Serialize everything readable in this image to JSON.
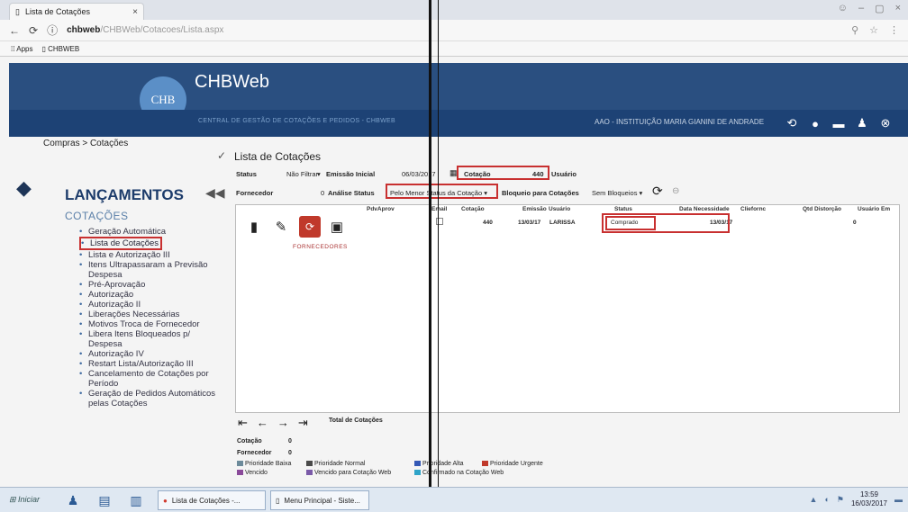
{
  "browser": {
    "tab_title": "Lista de Cotações",
    "url_host": "chbweb",
    "url_rest": "/CHBWeb/Cotacoes/Lista.aspx",
    "bookmarks": [
      "Apps",
      "CHBWEB"
    ]
  },
  "header": {
    "logo_text": "CHB",
    "brand": "CHBWeb",
    "info": "CENTRAL DE GESTÃO DE COTAÇÕES E PEDIDOS - CHBWEB",
    "user": "AAO - INSTITUIÇÃO MARIA GIANINI DE ANDRADE"
  },
  "breadcrumb": "Compras > Cotações",
  "sidebar": {
    "title": "LANÇAMENTOS",
    "subtitle": "COTAÇÕES",
    "items": [
      "Geração Automática",
      "Lista de Cotações",
      "Lista e Autorização III",
      "Itens Ultrapassaram a Previsão Despesa",
      "Pré-Aprovação",
      "Autorização",
      "Autorização II",
      "Liberações Necessárias",
      "Motivos Troca de Fornecedor",
      "Libera Itens Bloqueados p/ Despesa",
      "Autorização IV",
      "Restart Lista/Autorização III",
      "Cancelamento de Cotações por Período",
      "Geração de Pedidos Automáticos pelas Cotações"
    ]
  },
  "form": {
    "title": "Lista de Cotações",
    "status_label": "Status",
    "status_value": "Não Filtrar",
    "emissao_label": "Emissão Inicial",
    "emissao_value": "06/03/2017",
    "cotacao_label": "Cotação",
    "cotacao_value": "440",
    "usuario_label": "Usuário",
    "fornecedor_label": "Fornecedor",
    "fornecedor_value": "0",
    "analise_label": "Análise Status",
    "analise_value": "Pelo Menor Status da Cotação",
    "bloqueio_label": "Bloqueio para Cotações",
    "bloqueio_value": "Sem Bloqueios"
  },
  "grid": {
    "columns": [
      "PdvAprov",
      "Email",
      "Cotação",
      "Emissão",
      "Usuário",
      "Status",
      "Data Necessidade",
      "Cliefornc",
      "Qtd Distorção",
      "Usuário Em"
    ],
    "row": {
      "cotacao": "440",
      "emissao": "13/03/17",
      "usuario": "LARISSA",
      "status": "Comprado",
      "data_necessidade": "13/03/17",
      "qtd": "0"
    },
    "fornecedores_link": "FORNECEDORES"
  },
  "footer": {
    "total_label": "Total de Cotações",
    "cotacao_label": "Cotação",
    "cotacao_value": "0",
    "fornecedor_label": "Fornecedor",
    "fornecedor_value": "0",
    "legend": [
      {
        "label": "Prioridade Baixa",
        "color": "#6c8a9a"
      },
      {
        "label": "Prioridade Normal",
        "color": "#4a4a4a"
      },
      {
        "label": "Prioridade Alta",
        "color": "#3358b5"
      },
      {
        "label": "Prioridade Urgente",
        "color": "#c0392b"
      },
      {
        "label": "Vencido",
        "color": "#8a4a9a"
      },
      {
        "label": "Vencido para Cotação Web",
        "color": "#7a5aa8"
      },
      {
        "label": "Confirmado na Cotação Web",
        "color": "#2fa4c8"
      }
    ]
  },
  "taskbar": {
    "start": "Iniciar",
    "apps": [
      "Lista de Cotações -...",
      "Menu Principal - Siste..."
    ],
    "time": "13:59",
    "date": "16/03/2017"
  }
}
